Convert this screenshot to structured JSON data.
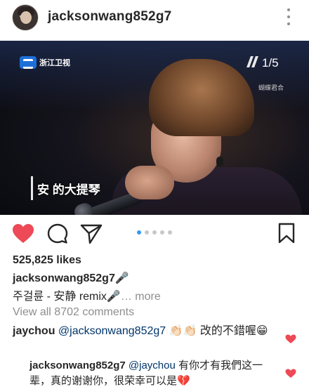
{
  "post": {
    "username": "jacksonwang852g7",
    "more_icon": "more-vertical-icon"
  },
  "photo": {
    "channel_logo_text": "浙江卫视",
    "counter": "1/5",
    "watermark": "蝴蝶君合",
    "subtitle_text": "安 的大提琴"
  },
  "actions": {
    "like_icon": "heart-filled-icon",
    "like_color": "#ed4956",
    "comment_icon": "comment-icon",
    "share_icon": "share-icon",
    "save_icon": "bookmark-icon",
    "carousel": {
      "total": 5,
      "active_index": 0,
      "active_color": "#3897f0"
    }
  },
  "stats": {
    "likes": "525,825 likes"
  },
  "caption": {
    "username": "jacksonwang852g7",
    "username_emoji": "🎤",
    "text": "주걸륜 - 安静 remix🎤",
    "more": "… more"
  },
  "comments": {
    "view_all": "View all 8702 comments",
    "items": [
      {
        "username": "jaychou",
        "mention": "@jacksonwang852g7",
        "text": "👏🏻👏🏻 改的不錯喔😁"
      }
    ],
    "reply": {
      "username": "jacksonwang852g7",
      "mention": "@jaychou",
      "text": "有你才有我們这一辈，真的谢谢你，很荣幸可以是💔"
    }
  }
}
